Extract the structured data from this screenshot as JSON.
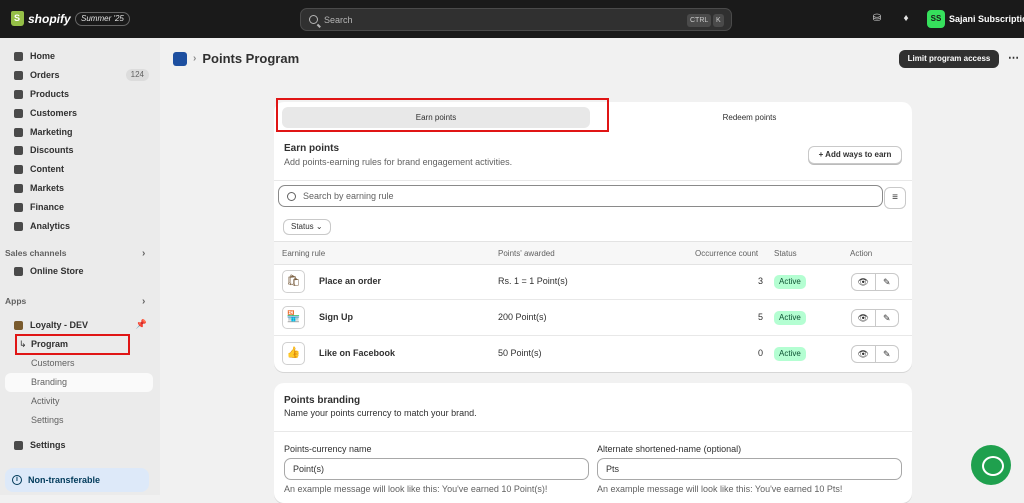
{
  "topbar": {
    "brand": "shopify",
    "edition": "Summer '25",
    "search_placeholder": "Search",
    "shortcut_ctrl": "CTRL",
    "shortcut_key": "K",
    "avatar_initials": "SS",
    "store_name": "Sajani Subscription"
  },
  "sidebar": {
    "items": [
      {
        "label": "Home",
        "icon": "home-icon"
      },
      {
        "label": "Orders",
        "icon": "orders-icon",
        "badge": "124"
      },
      {
        "label": "Products",
        "icon": "tag-icon"
      },
      {
        "label": "Customers",
        "icon": "person-icon"
      },
      {
        "label": "Marketing",
        "icon": "target-icon"
      },
      {
        "label": "Discounts",
        "icon": "discount-icon"
      },
      {
        "label": "Content",
        "icon": "content-icon"
      },
      {
        "label": "Markets",
        "icon": "globe-icon"
      },
      {
        "label": "Finance",
        "icon": "bank-icon"
      },
      {
        "label": "Analytics",
        "icon": "bar-chart-icon"
      }
    ],
    "sales_channels_label": "Sales channels",
    "online_store": "Online Store",
    "apps_label": "Apps",
    "app_name": "Loyalty - DEV",
    "app_subitems": [
      "Program",
      "Customers",
      "Branding",
      "Activity",
      "Settings"
    ],
    "settings": "Settings",
    "non_transferable": "Non-transferable"
  },
  "page": {
    "title": "Points Program",
    "limit_button": "Limit program access"
  },
  "earn_card": {
    "tabs": [
      "Earn points",
      "Redeem points"
    ],
    "heading": "Earn points",
    "description": "Add points-earning rules for brand engagement activities.",
    "add_button": "+ Add ways to earn",
    "search_placeholder": "Search by earning rule",
    "status_filter": "Status",
    "columns": [
      "Earning rule",
      "Points' awarded",
      "Occurrence count",
      "Status",
      "Action"
    ],
    "rows": [
      {
        "name": "Place an order",
        "points": "Rs. 1 = 1 Point(s)",
        "occurrences": "3",
        "status": "Active",
        "icon": "shopping-bag-icon"
      },
      {
        "name": "Sign Up",
        "points": "200 Point(s)",
        "occurrences": "5",
        "status": "Active",
        "icon": "storefront-icon"
      },
      {
        "name": "Like on Facebook",
        "points": "50 Point(s)",
        "occurrences": "0",
        "status": "Active",
        "icon": "thumbs-up-icon"
      }
    ]
  },
  "branding_card": {
    "heading": "Points branding",
    "description": "Name your points currency to match your brand.",
    "currency_label": "Points-currency name",
    "currency_value": "Point(s)",
    "currency_help": "An example message will look like this: You've earned 10 Point(s)!",
    "short_label": "Alternate shortened-name (optional)",
    "short_value": "Pts",
    "short_help": "An example message will look like this: You've earned 10 Pts!"
  },
  "colors": {
    "active_badge_bg": "#b4fed2",
    "highlight_box": "#e01515",
    "chat_button": "#1fa04e",
    "avatar_bg": "#36e05c"
  }
}
